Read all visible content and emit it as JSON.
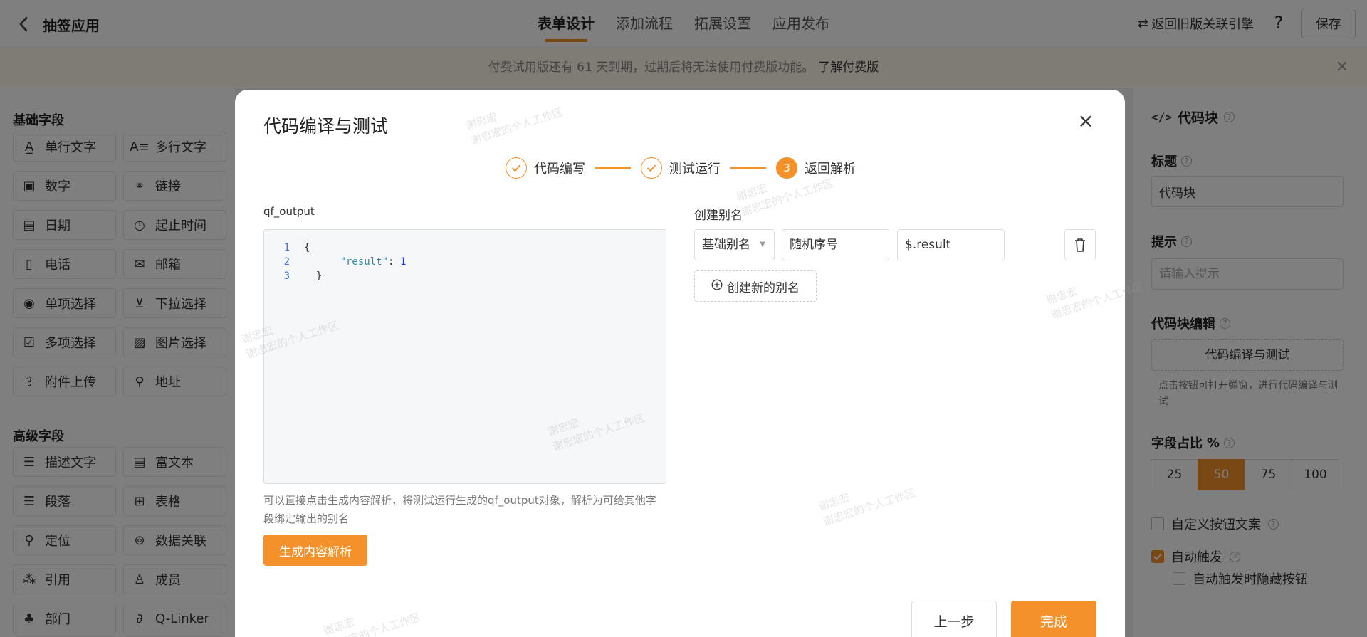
{
  "header": {
    "app_title": "抽签应用",
    "tabs": [
      "表单设计",
      "添加流程",
      "拓展设置",
      "应用发布"
    ],
    "switch_link": "返回旧版关联引擎",
    "save_label": "保存"
  },
  "notice": {
    "text": "付费试用版还有 61 天到期，过期后将无法使用付费版功能。",
    "link": "了解付费版"
  },
  "sidebar": {
    "basic_title": "基础字段",
    "basic_fields": [
      "单行文字",
      "多行文字",
      "数字",
      "链接",
      "日期",
      "起止时间",
      "电话",
      "邮箱",
      "单项选择",
      "下拉选择",
      "多项选择",
      "图片选择",
      "附件上传",
      "地址"
    ],
    "advanced_title": "高级字段",
    "advanced_fields": [
      "描述文字",
      "富文本",
      "段落",
      "表格",
      "定位",
      "数据关联",
      "引用",
      "成员",
      "部门",
      "Q-Linker"
    ]
  },
  "right_panel": {
    "title": "代码块",
    "title_label": "标题",
    "title_value": "代码块",
    "hint_label": "提示",
    "hint_placeholder": "请输入提示",
    "code_edit_label": "代码块编辑",
    "code_edit_button": "代码编译与测试",
    "code_edit_hint": "点击按钮可打开弹窗，进行代码编译与测试",
    "ratio_label": "字段占比",
    "ratio_unit": "%",
    "ratio_options": [
      "25",
      "50",
      "75",
      "100"
    ],
    "ratio_selected": "50",
    "custom_button_text": "自定义按钮文案",
    "auto_trigger": "自动触发",
    "auto_trigger_checked": true,
    "hide_button_on_auto": "自动触发时隐藏按钮"
  },
  "modal": {
    "title": "代码编译与测试",
    "steps": [
      {
        "label": "代码编写",
        "status": "done"
      },
      {
        "label": "测试运行",
        "status": "done"
      },
      {
        "label": "返回解析",
        "status": "current",
        "number": "3"
      }
    ],
    "code_label": "qf_output",
    "code_lines": [
      {
        "no": "1",
        "text": "{"
      },
      {
        "no": "2",
        "key": "\"result\"",
        "value": "1"
      },
      {
        "no": "3",
        "text": "}"
      }
    ],
    "code_help": "可以直接点击生成内容解析，将测试运行生成的qf_output对象，解析为可给其他字段绑定输出的别名",
    "generate_button": "生成内容解析",
    "alias_label": "创建别名",
    "alias_type": "基础别名",
    "alias_name": "随机序号",
    "alias_path": "$.result",
    "new_alias_button": "创建新的别名",
    "prev_button": "上一步",
    "done_button": "完成"
  },
  "watermark": {
    "name": "谢忠宏",
    "workspace": "谢忠宏的个人工作区"
  },
  "colors": {
    "accent": "#f5912b",
    "mask": "rgba(0,0,0,0.5)"
  }
}
